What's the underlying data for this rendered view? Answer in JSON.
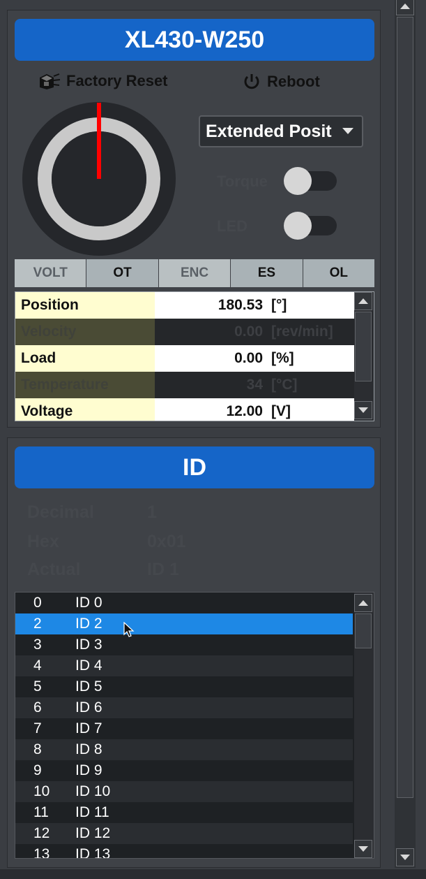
{
  "motor": {
    "model": "XL430-W250",
    "factory_reset_label": "Factory Reset",
    "reboot_label": "Reboot",
    "operating_mode": "Extended Posit",
    "torque_label": "Torque",
    "led_label": "LED",
    "torque_on": false,
    "led_on": false,
    "dial_needle_angle_deg": 0,
    "flags": [
      {
        "label": "VOLT",
        "active": false
      },
      {
        "label": "OT",
        "active": true
      },
      {
        "label": "ENC",
        "active": false
      },
      {
        "label": "ES",
        "active": true
      },
      {
        "label": "OL",
        "active": true
      }
    ],
    "status_rows": [
      {
        "name": "Position",
        "value": "180.53",
        "unit": "[°]",
        "dim": false
      },
      {
        "name": "Velocity",
        "value": "0.00",
        "unit": "[rev/min]",
        "dim": true
      },
      {
        "name": "Load",
        "value": "0.00",
        "unit": "[%]",
        "dim": false
      },
      {
        "name": "Temperature",
        "value": "34",
        "unit": "[°C]",
        "dim": true
      },
      {
        "name": "Voltage",
        "value": "12.00",
        "unit": "[V]",
        "dim": false
      }
    ]
  },
  "id_panel": {
    "title": "ID",
    "decimal_label": "Decimal",
    "decimal_value": "1",
    "hex_label": "Hex",
    "hex_value": "0x01",
    "actual_label": "Actual",
    "actual_value": "ID 1",
    "list": [
      {
        "num": "0",
        "label": "ID 0"
      },
      {
        "num": "2",
        "label": "ID 2",
        "selected": true
      },
      {
        "num": "3",
        "label": "ID 3"
      },
      {
        "num": "4",
        "label": "ID 4"
      },
      {
        "num": "5",
        "label": "ID 5"
      },
      {
        "num": "6",
        "label": "ID 6"
      },
      {
        "num": "7",
        "label": "ID 7"
      },
      {
        "num": "8",
        "label": "ID 8"
      },
      {
        "num": "9",
        "label": "ID 9"
      },
      {
        "num": "10",
        "label": "ID 10"
      },
      {
        "num": "11",
        "label": "ID 11"
      },
      {
        "num": "12",
        "label": "ID 12"
      },
      {
        "num": "13",
        "label": "ID 13"
      }
    ]
  },
  "colors": {
    "accent": "#1565c8",
    "selection": "#1e88e5",
    "needle": "#ff0000"
  }
}
